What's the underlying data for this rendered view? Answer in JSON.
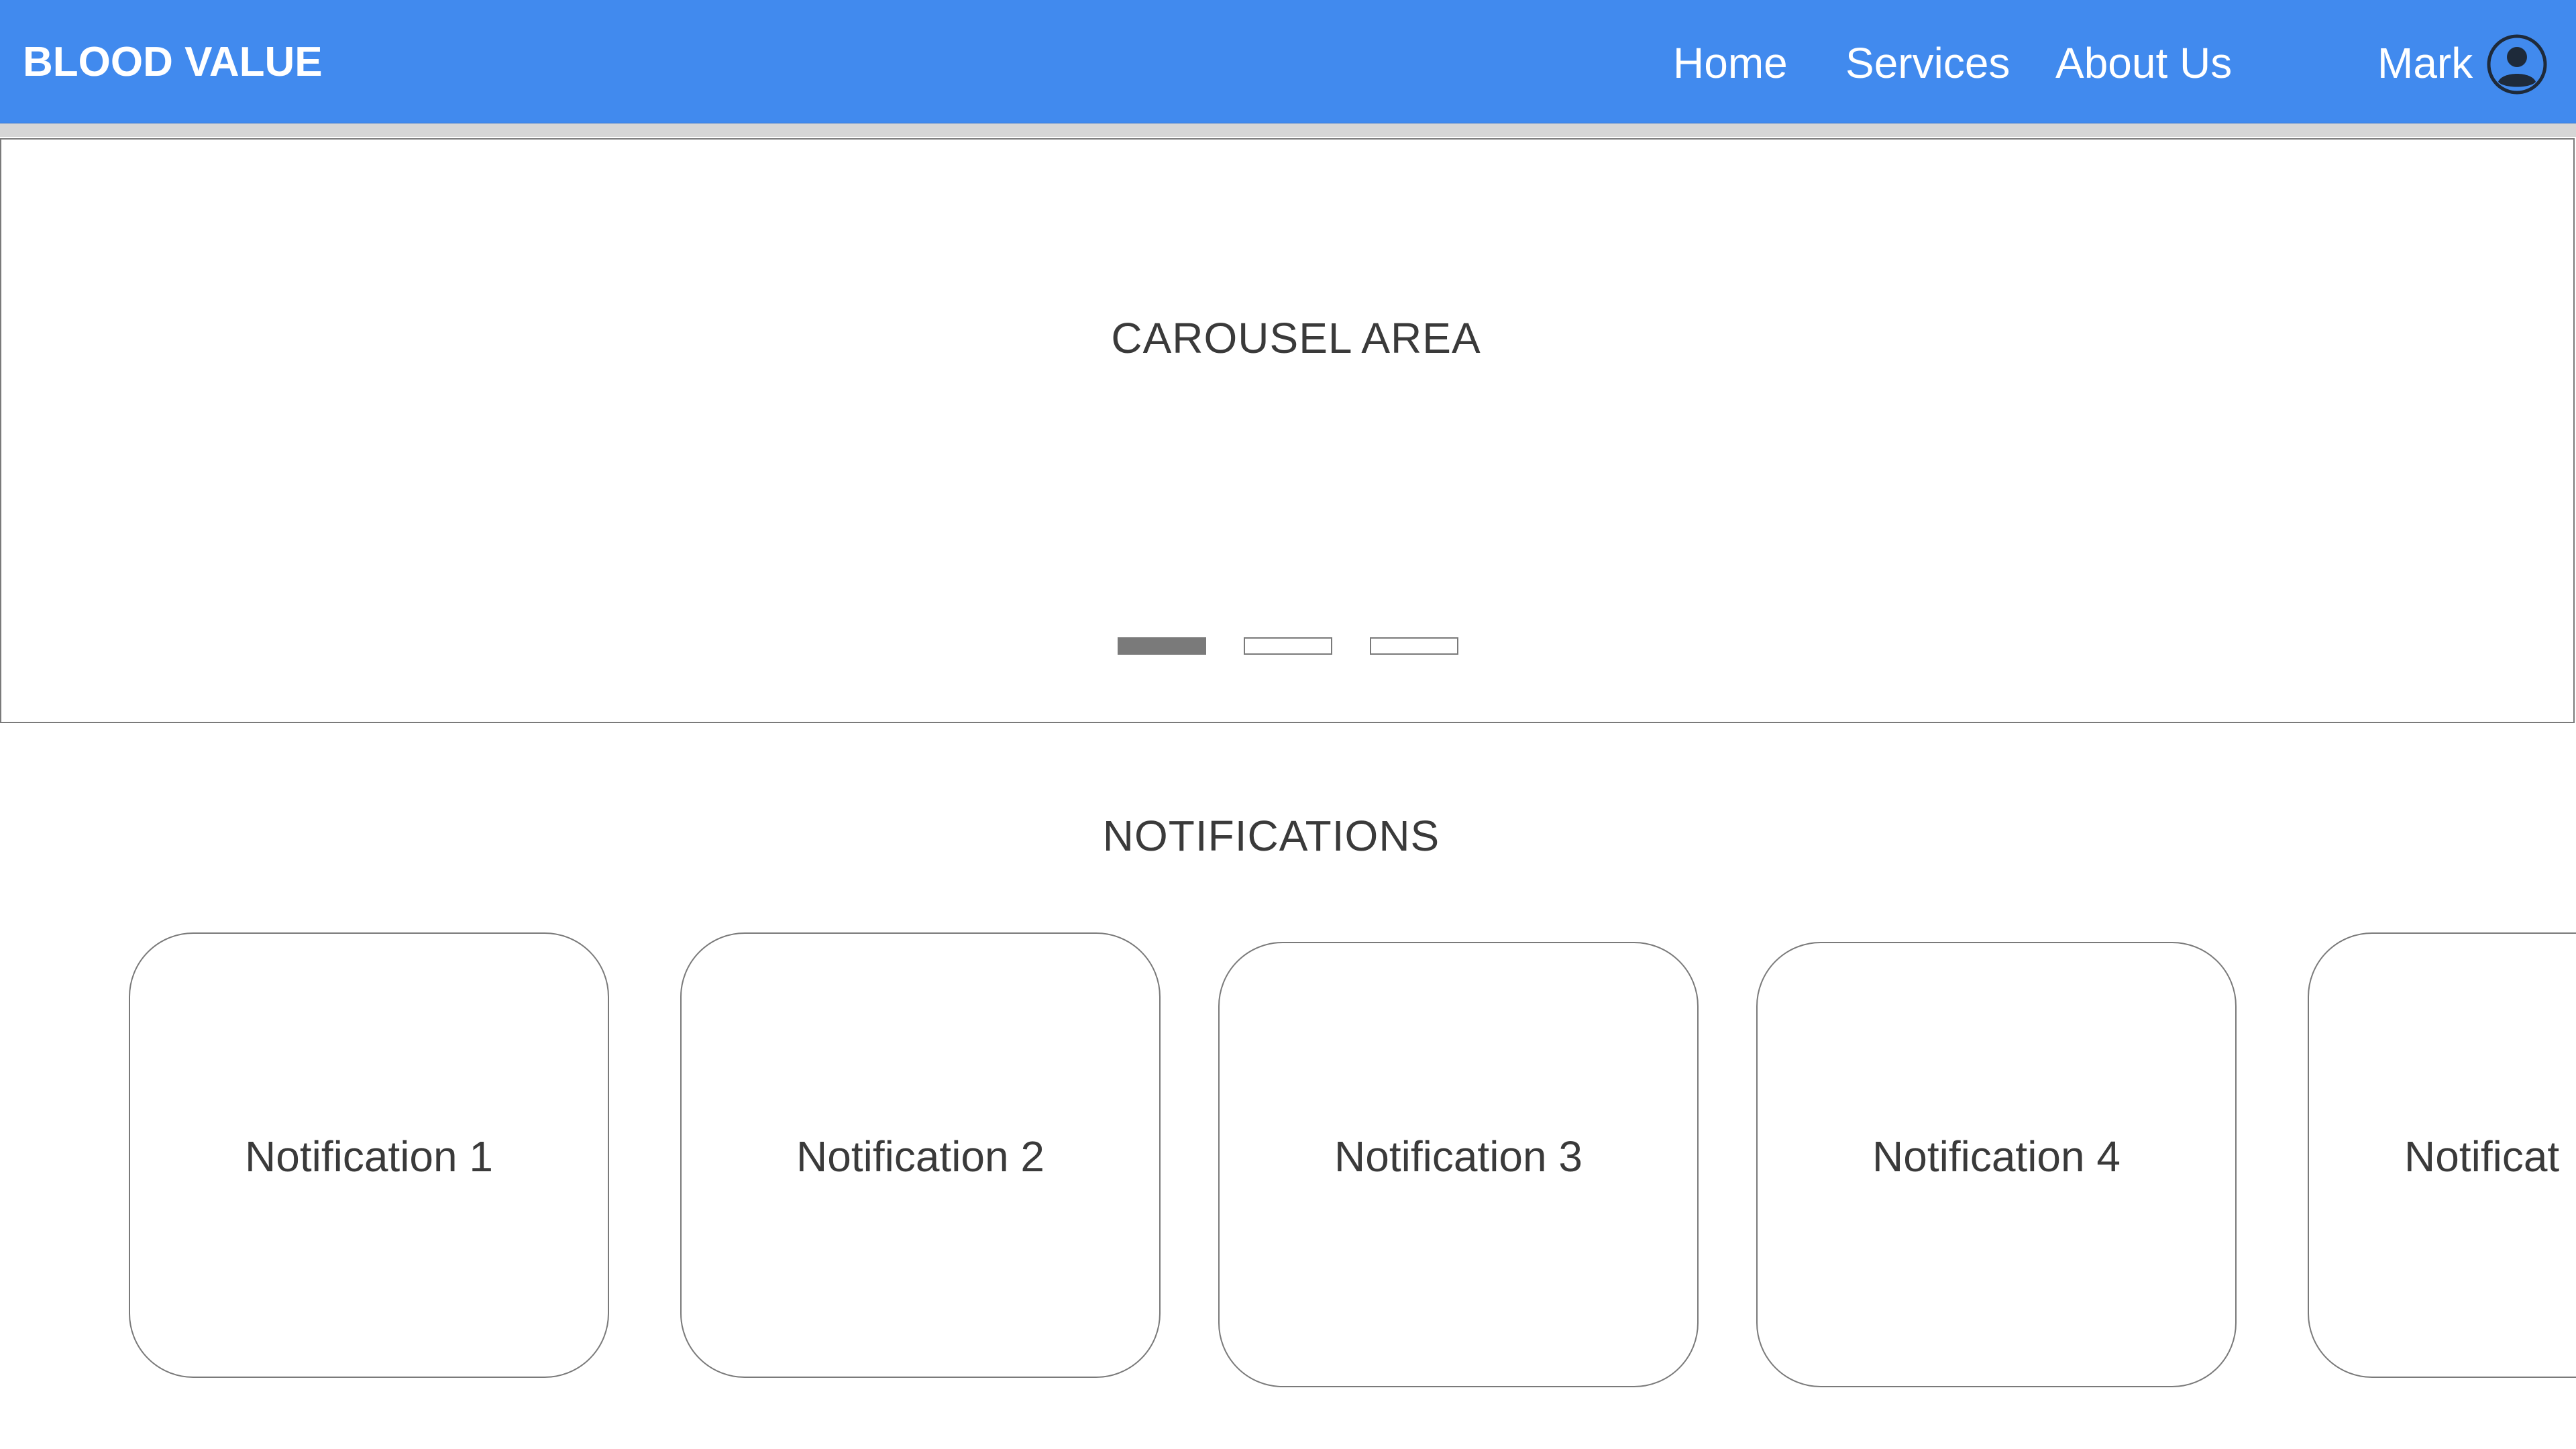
{
  "header": {
    "brand": "BLOOD VALUE",
    "nav": {
      "home": "Home",
      "services": "Services",
      "about": "About Us"
    },
    "user": {
      "name": "Mark",
      "avatar_icon": "user-avatar-icon"
    },
    "colors": {
      "navbar_bg": "#418aee",
      "navbar_text": "#ffffff"
    }
  },
  "carousel": {
    "title": "CAROUSEL AREA",
    "indicators": [
      {
        "active": true
      },
      {
        "active": false
      },
      {
        "active": false
      }
    ]
  },
  "notifications": {
    "title": "NOTIFICATIONS",
    "cards": [
      {
        "label": "Notification 1"
      },
      {
        "label": "Notification 2"
      },
      {
        "label": "Notification 3"
      },
      {
        "label": "Notification 4"
      },
      {
        "label": "Notificat"
      }
    ]
  }
}
